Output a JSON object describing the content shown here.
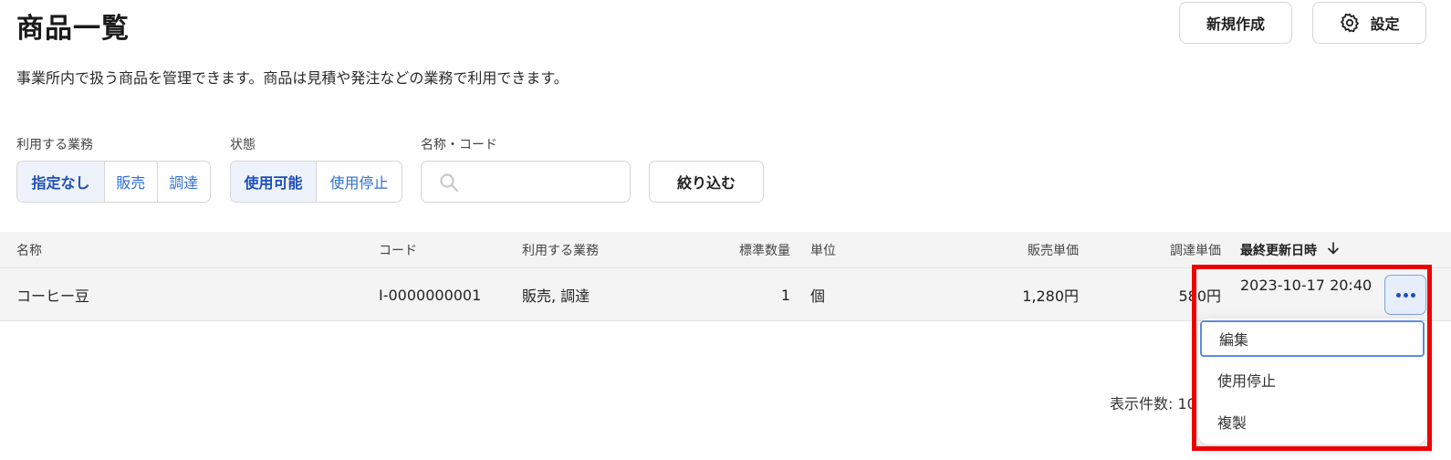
{
  "page": {
    "title": "商品一覧",
    "description": "事業所内で扱う商品を管理できます。商品は見積や発注などの業務で利用できます。"
  },
  "header_actions": {
    "new_label": "新規作成",
    "settings_label": "設定",
    "settings_icon": "gear-icon"
  },
  "filters": {
    "business": {
      "label": "利用する業務",
      "options": [
        "指定なし",
        "販売",
        "調達"
      ],
      "selected": "指定なし"
    },
    "status": {
      "label": "状態",
      "options": [
        "使用可能",
        "使用停止"
      ],
      "selected": "使用可能"
    },
    "name_code": {
      "label": "名称・コード",
      "value": "",
      "icon": "search-icon"
    },
    "apply_label": "絞り込む"
  },
  "table": {
    "columns": [
      "名称",
      "コード",
      "利用する業務",
      "標準数量",
      "単位",
      "販売単価",
      "調達単価",
      "最終更新日時"
    ],
    "sort_column": "最終更新日時",
    "sort_direction": "desc",
    "rows": [
      {
        "name": "コーヒー豆",
        "code": "I-0000000001",
        "business": "販売, 調達",
        "quantity": "1",
        "unit": "個",
        "sale_price": "1,280円",
        "purchase_price": "580円",
        "updated_at": "2023-10-17 20:40"
      }
    ]
  },
  "row_menu": {
    "items": [
      "編集",
      "使用停止",
      "複製"
    ],
    "focused": "編集"
  },
  "pagination": {
    "label": "表示件数: 10"
  },
  "colors": {
    "accent": "#1c4fb8",
    "link": "#2f6fd6",
    "highlight": "#ee0000"
  }
}
